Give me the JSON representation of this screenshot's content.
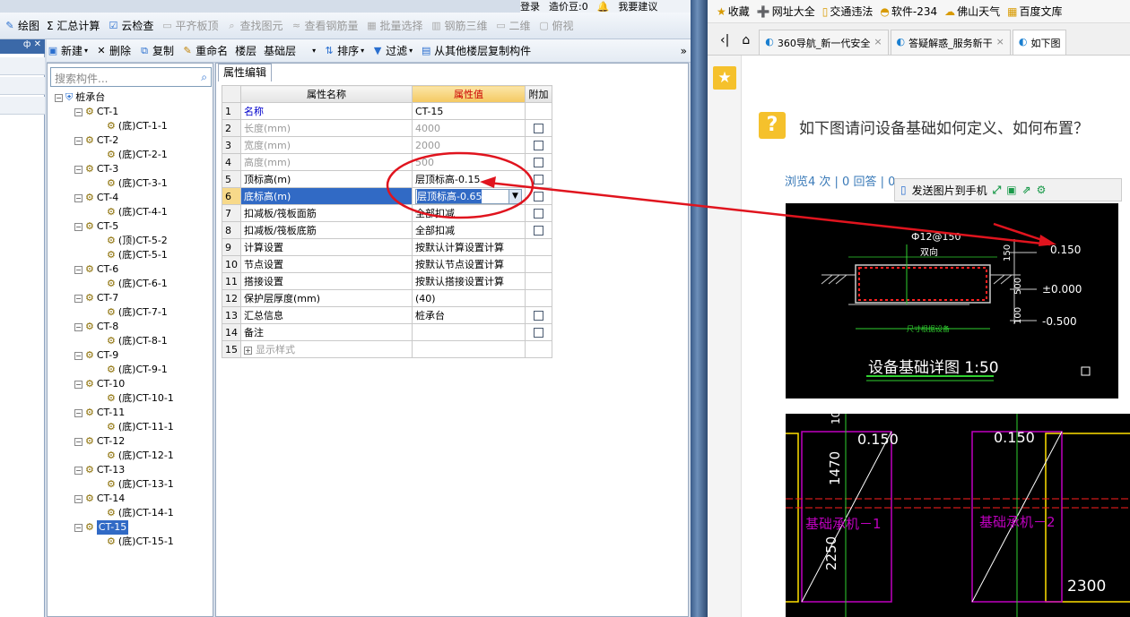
{
  "app": {
    "topstrip": {
      "login": "登录",
      "price": "造价豆:0",
      "suggest": "我要建议"
    },
    "toolbar1": [
      {
        "label": "绘图",
        "icon": "draw-icon",
        "enabled": true
      },
      {
        "label": "Σ 汇总计算",
        "icon": "sum-icon",
        "enabled": true
      },
      {
        "label": "云检查",
        "icon": "cloud-check-icon",
        "enabled": true
      },
      {
        "label": "平齐板顶",
        "icon": "align-icon",
        "enabled": false
      },
      {
        "label": "查找图元",
        "icon": "find-icon",
        "enabled": false
      },
      {
        "label": "查看钢筋量",
        "icon": "rebar-icon",
        "enabled": false
      },
      {
        "label": "批量选择",
        "icon": "batch-icon",
        "enabled": false
      },
      {
        "label": "钢筋三维",
        "icon": "3d-icon",
        "enabled": false
      },
      {
        "label": "二维",
        "icon": "2d-icon",
        "enabled": false
      },
      {
        "label": "俯视",
        "icon": "top-view-icon",
        "enabled": false
      }
    ],
    "toolbar2": {
      "new": "新建",
      "delete": "删除",
      "copy": "复制",
      "rename": "重命名",
      "floor": "楼层",
      "floor_value": "基础层",
      "sort": "排序",
      "filter": "过滤",
      "copy_from": "从其他楼层复制构件"
    },
    "search_placeholder": "搜索构件...",
    "tree": {
      "root": "桩承台",
      "items": [
        {
          "name": "CT-1",
          "children": [
            "(底)CT-1-1"
          ]
        },
        {
          "name": "CT-2",
          "children": [
            "(底)CT-2-1"
          ]
        },
        {
          "name": "CT-3",
          "children": [
            "(底)CT-3-1"
          ]
        },
        {
          "name": "CT-4",
          "children": [
            "(底)CT-4-1"
          ]
        },
        {
          "name": "CT-5",
          "children": [
            "(顶)CT-5-2",
            "(底)CT-5-1"
          ]
        },
        {
          "name": "CT-6",
          "children": [
            "(底)CT-6-1"
          ]
        },
        {
          "name": "CT-7",
          "children": [
            "(底)CT-7-1"
          ]
        },
        {
          "name": "CT-8",
          "children": [
            "(底)CT-8-1"
          ]
        },
        {
          "name": "CT-9",
          "children": [
            "(底)CT-9-1"
          ]
        },
        {
          "name": "CT-10",
          "children": [
            "(底)CT-10-1"
          ]
        },
        {
          "name": "CT-11",
          "children": [
            "(底)CT-11-1"
          ]
        },
        {
          "name": "CT-12",
          "children": [
            "(底)CT-12-1"
          ]
        },
        {
          "name": "CT-13",
          "children": [
            "(底)CT-13-1"
          ]
        },
        {
          "name": "CT-14",
          "children": [
            "(底)CT-14-1"
          ]
        },
        {
          "name": "CT-15",
          "children": [
            "(底)CT-15-1"
          ],
          "selected": true
        }
      ]
    },
    "panel_tab": "属性编辑",
    "grid_headers": {
      "name": "属性名称",
      "value": "属性值",
      "extra": "附加"
    },
    "grid_rows": [
      {
        "n": "1",
        "name": "名称",
        "value": "CT-15",
        "style": "blue",
        "cb": false
      },
      {
        "n": "2",
        "name": "长度(mm)",
        "value": "4000",
        "style": "gray",
        "cb": true
      },
      {
        "n": "3",
        "name": "宽度(mm)",
        "value": "2000",
        "style": "gray",
        "cb": true
      },
      {
        "n": "4",
        "name": "高度(mm)",
        "value": "500",
        "style": "gray",
        "cb": true
      },
      {
        "n": "5",
        "name": "顶标高(m)",
        "value": "层顶标高-0.15",
        "style": "",
        "cb": true
      },
      {
        "n": "6",
        "name": "底标高(m)",
        "value": "层顶标高-0.65",
        "style": "selected",
        "cb": true
      },
      {
        "n": "7",
        "name": "扣减板/筏板面筋",
        "value": "全部扣减",
        "style": "",
        "cb": true
      },
      {
        "n": "8",
        "name": "扣减板/筏板底筋",
        "value": "全部扣减",
        "style": "",
        "cb": true
      },
      {
        "n": "9",
        "name": "计算设置",
        "value": "按默认计算设置计算",
        "style": "",
        "cb": false
      },
      {
        "n": "10",
        "name": "节点设置",
        "value": "按默认节点设置计算",
        "style": "",
        "cb": false
      },
      {
        "n": "11",
        "name": "搭接设置",
        "value": "按默认搭接设置计算",
        "style": "",
        "cb": false
      },
      {
        "n": "12",
        "name": "保护层厚度(mm)",
        "value": "(40)",
        "style": "",
        "cb": false
      },
      {
        "n": "13",
        "name": "汇总信息",
        "value": "桩承台",
        "style": "",
        "cb": true
      },
      {
        "n": "14",
        "name": "备注",
        "value": "",
        "style": "",
        "cb": true
      },
      {
        "n": "15",
        "name": "显示样式",
        "value": "",
        "style": "gray",
        "cb": false,
        "expand": true
      }
    ]
  },
  "browser": {
    "favbar": [
      "收藏",
      "网址大全",
      "交通违法",
      "软件-234",
      "佛山天气",
      "百度文库"
    ],
    "tabs": [
      {
        "label": "360导航_新一代安全",
        "active": false
      },
      {
        "label": "答疑解惑_服务新干",
        "active": false
      },
      {
        "label": "如下图",
        "active": true
      }
    ],
    "question": "如下图请问设备基础如何定义、如何布置？",
    "meta": "浏览4 次 | 0 回答 | 0 ",
    "send_to_phone": "发送图片到手机",
    "cad1": {
      "rebar": "Ф12@150",
      "dir": "双向",
      "d150": "150",
      "d500": "500",
      "d100": "100",
      "top": "0.150",
      "zero": "±0.000",
      "bottom": "-0.500",
      "sizenote": "尺寸根据设备",
      "title": "设备基础详图 1:50"
    },
    "cad2": {
      "l1": "0.150",
      "l2": "0.150",
      "dim1": "1470",
      "dim2": "2250",
      "dim3": "2300",
      "dim4": "10",
      "m1": "基础承机－1",
      "m2": "基础承机－2"
    }
  },
  "colors": {
    "annotation_red": "#e0141e",
    "selection_blue": "#316ac5",
    "header_orange": "#f4c860",
    "cad_magenta": "#c000c0",
    "cad_red": "#ff2020",
    "cad_green": "#30d030"
  }
}
